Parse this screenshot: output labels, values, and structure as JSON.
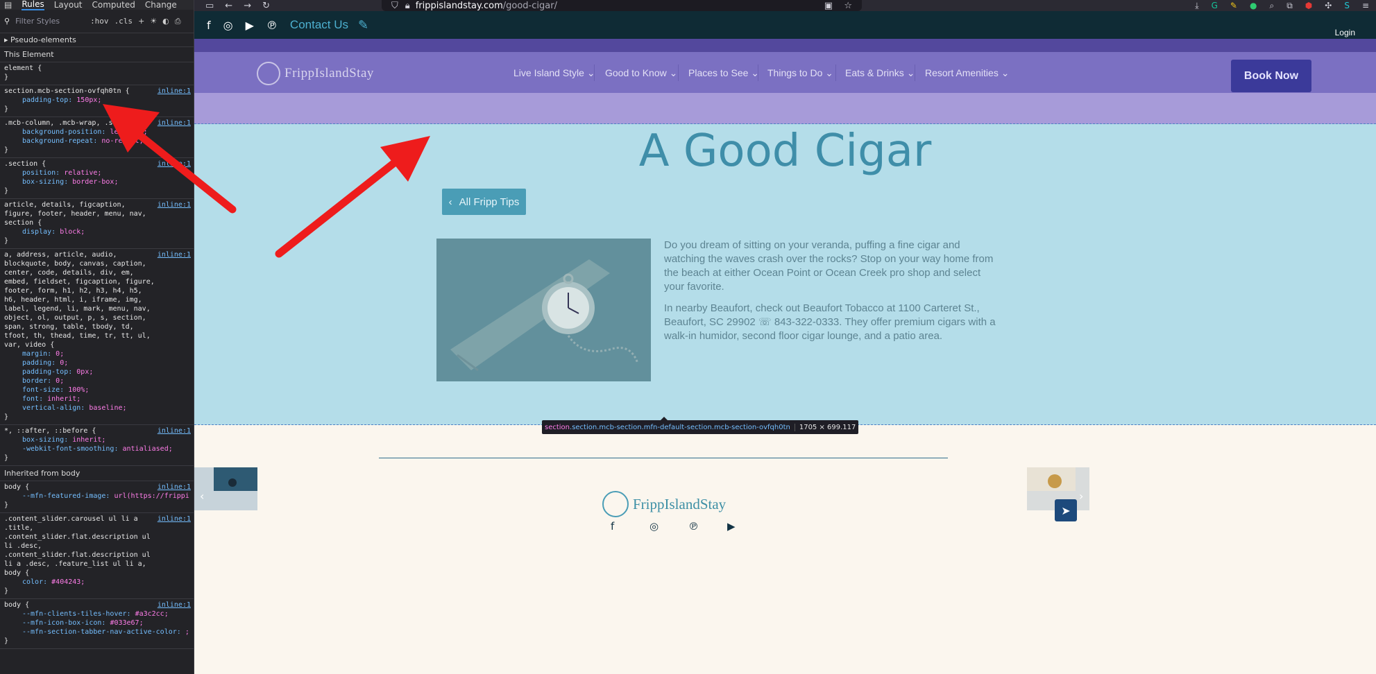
{
  "devtools": {
    "tabs": [
      "Rules",
      "Layout",
      "Computed",
      "Change"
    ],
    "filter_placeholder": "Filter Styles",
    "toolbar_buttons": [
      ":hov",
      ".cls",
      "+"
    ],
    "pseudo_elements_label": "Pseudo-elements",
    "this_element_label": "This Element",
    "inherited_label": "Inherited from body",
    "rules": [
      {
        "selector": "element",
        "source": "",
        "decls": []
      },
      {
        "selector": "section.mcb-section-ovfqh0tn",
        "source": "inline:1",
        "decls": [
          {
            "p": "padding-top",
            "v": "150px"
          }
        ]
      },
      {
        "selector": ".mcb-column, .mcb-wrap, .se…",
        "source": "inline:1",
        "decls": [
          {
            "p": "background-position",
            "v": "left top"
          },
          {
            "p": "background-repeat",
            "v": "no-repeat"
          }
        ]
      },
      {
        "selector": ".section",
        "source": "inline:1",
        "decls": [
          {
            "p": "position",
            "v": "relative"
          },
          {
            "p": "box-sizing",
            "v": "border-box"
          }
        ]
      },
      {
        "selector": "article, details, figcaption, figure, footer, header, menu, nav, section",
        "source": "inline:1",
        "decls": [
          {
            "p": "display",
            "v": "block"
          }
        ]
      },
      {
        "selector": "a, address, article, audio, blockquote, body, canvas, caption, center, code, details, div, em, embed, fieldset, figcaption, figure, footer, form, h1, h2, h3, h4, h5, h6, header, html, i, iframe, img, label, legend, li, mark, menu, nav, object, ol, output, p, s, section, span, strong, table, tbody, td, tfoot, th, thead, time, tr, tt, ul, var, video",
        "source": "inline:1",
        "decls": [
          {
            "p": "margin",
            "v": "0"
          },
          {
            "p": "padding",
            "v": "0"
          },
          {
            "p": "padding-top",
            "v": "0px"
          },
          {
            "p": "border",
            "v": "0"
          },
          {
            "p": "font-size",
            "v": "100%"
          },
          {
            "p": "font",
            "v": "inherit"
          },
          {
            "p": "vertical-align",
            "v": "baseline"
          }
        ]
      },
      {
        "selector": "*, ::after, ::before",
        "source": "inline:1",
        "decls": [
          {
            "p": "box-sizing",
            "v": "inherit"
          },
          {
            "p": "-webkit-font-smoothing",
            "v": "antialiased"
          }
        ]
      }
    ],
    "inherited_rules": [
      {
        "selector": "body",
        "source": "inline:1",
        "decls": [
          {
            "p": "--mfn-featured-image",
            "v": "url(https://frippislandstay.com/wp-content/uploads/2021/09/cigar1080.jpg)"
          }
        ]
      },
      {
        "selector": ".content_slider.carousel ul li a .title, .content_slider.flat.description ul li .desc, .content_slider.flat.description ul li a .desc, .feature_list ul li a, body",
        "source": "inline:1",
        "decls": [
          {
            "p": "color",
            "v": "#404243"
          }
        ]
      },
      {
        "selector": "body",
        "source": "inline:1",
        "decls": [
          {
            "p": "--mfn-clients-tiles-hover",
            "v": "#a3c2cc"
          },
          {
            "p": "--mfn-icon-box-icon",
            "v": "#033e67"
          },
          {
            "p": "--mfn-section-tabber-nav-active-color",
            "v": ""
          }
        ]
      }
    ]
  },
  "browser": {
    "url_host": "frippislandstay.com",
    "url_path": "/good-cigar/"
  },
  "site": {
    "contact_label": "Contact Us",
    "login_label": "Login",
    "logo_text": "FrippIslandStay",
    "nav_items": [
      "Live Island Style",
      "Good to Know",
      "Places to See",
      "Things to Do",
      "Eats & Drinks",
      "Resort Amenities"
    ],
    "book_now_label": "Book Now",
    "page_title": "A Good Cigar",
    "back_button_label": "All Fripp Tips",
    "paragraphs": [
      "Do you dream of sitting on your veranda, puffing a fine cigar and watching the waves crash over the rocks?  Stop on your way home from the beach at either Ocean Point or Ocean Creek pro shop and select your favorite.",
      "In nearby Beaufort, check out Beaufort Tobacco at 1100 Carteret St., Beaufort, SC 29902 ☏ 843-322-0333.  They offer premium cigars with a walk-in humidor, second floor cigar lounge, and a patio area."
    ],
    "inspector_tooltip": {
      "tag": "section",
      "classes": ".section.mcb-section.mfn-default-section.mcb-section-ovfqh0tn",
      "size": "1705 × 699.117"
    },
    "footer_logo_text": "FrippIslandStay"
  }
}
